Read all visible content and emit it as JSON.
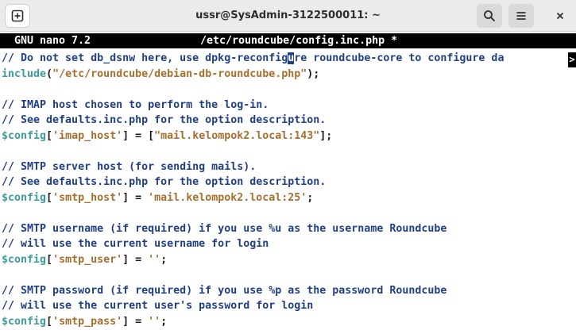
{
  "window": {
    "title": "ussr@SysAdmin-3122500011: ~",
    "buttons": {
      "new_tab_icon": "new-tab-icon",
      "search_icon": "search-icon",
      "menu_icon": "hamburger-menu-icon",
      "close_icon": "close-icon"
    }
  },
  "nano": {
    "version": "GNU nano 7.2",
    "filename": "/etc/roundcube/config.inc.php *",
    "overflow_marker": ">"
  },
  "lines": [
    {
      "parts": [
        {
          "t": "// Do not set db_dsnw here, use dpkg-reconfig",
          "c": "c-comment"
        },
        {
          "t": "u",
          "c": "cursor"
        },
        {
          "t": "re roundcube-core to configure da",
          "c": "c-comment"
        }
      ]
    },
    {
      "parts": [
        {
          "t": "include",
          "c": "c-var"
        },
        {
          "t": "(",
          "c": "c-plain"
        },
        {
          "t": "\"/etc/roundcube/debian-db-roundcube.php\"",
          "c": "c-str"
        },
        {
          "t": ");",
          "c": "c-plain"
        }
      ]
    },
    {
      "parts": []
    },
    {
      "parts": [
        {
          "t": "// IMAP host chosen to perform the log-in.",
          "c": "c-comment"
        }
      ]
    },
    {
      "parts": [
        {
          "t": "// See defaults.inc.php for the option description.",
          "c": "c-comment"
        }
      ]
    },
    {
      "parts": [
        {
          "t": "$config",
          "c": "c-var"
        },
        {
          "t": "[",
          "c": "c-plain"
        },
        {
          "t": "'imap_host'",
          "c": "c-str"
        },
        {
          "t": "] = [",
          "c": "c-plain"
        },
        {
          "t": "\"mail.kelompok2.local:143\"",
          "c": "c-str"
        },
        {
          "t": "];",
          "c": "c-plain"
        }
      ]
    },
    {
      "parts": []
    },
    {
      "parts": [
        {
          "t": "// SMTP server host (for sending mails).",
          "c": "c-comment"
        }
      ]
    },
    {
      "parts": [
        {
          "t": "// See defaults.inc.php for the option description.",
          "c": "c-comment"
        }
      ]
    },
    {
      "parts": [
        {
          "t": "$config",
          "c": "c-var"
        },
        {
          "t": "[",
          "c": "c-plain"
        },
        {
          "t": "'smtp_host'",
          "c": "c-str"
        },
        {
          "t": "] = ",
          "c": "c-plain"
        },
        {
          "t": "'mail.kelompok2.local:25'",
          "c": "c-str"
        },
        {
          "t": ";",
          "c": "c-plain"
        }
      ]
    },
    {
      "parts": []
    },
    {
      "parts": [
        {
          "t": "// SMTP username (if required) if you use %u as the username Roundcube",
          "c": "c-comment"
        }
      ]
    },
    {
      "parts": [
        {
          "t": "// will use the current username for login",
          "c": "c-comment"
        }
      ]
    },
    {
      "parts": [
        {
          "t": "$config",
          "c": "c-var"
        },
        {
          "t": "[",
          "c": "c-plain"
        },
        {
          "t": "'smtp_user'",
          "c": "c-str"
        },
        {
          "t": "] = ",
          "c": "c-plain"
        },
        {
          "t": "''",
          "c": "c-str"
        },
        {
          "t": ";",
          "c": "c-plain"
        }
      ]
    },
    {
      "parts": []
    },
    {
      "parts": [
        {
          "t": "// SMTP password (if required) if you use %p as the password Roundcube",
          "c": "c-comment"
        }
      ]
    },
    {
      "parts": [
        {
          "t": "// will use the current user's password for login",
          "c": "c-comment"
        }
      ]
    },
    {
      "parts": [
        {
          "t": "$config",
          "c": "c-var"
        },
        {
          "t": "[",
          "c": "c-plain"
        },
        {
          "t": "'smtp_pass'",
          "c": "c-str"
        },
        {
          "t": "] = ",
          "c": "c-plain"
        },
        {
          "t": "''",
          "c": "c-str"
        },
        {
          "t": ";",
          "c": "c-plain"
        }
      ]
    }
  ]
}
